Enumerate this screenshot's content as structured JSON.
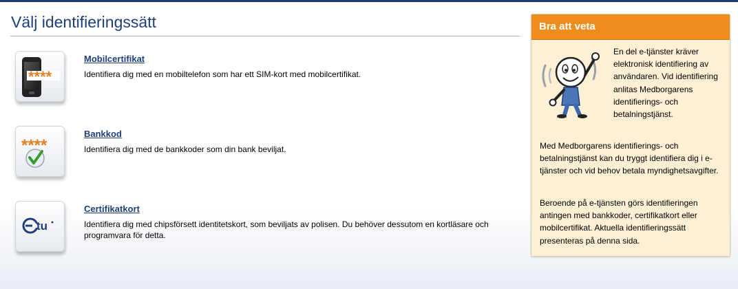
{
  "page": {
    "title": "Välj identifieringssätt"
  },
  "methods": [
    {
      "icon": "mobile-phone-icon",
      "icon_text": "****",
      "label": "Mobilcertifikat",
      "description": "Identifiera dig med en mobiltelefon som har ett SIM-kort med mobilcertifikat."
    },
    {
      "icon": "bank-code-checkmark-icon",
      "icon_text": "****",
      "label": "Bankkod",
      "description": "Identifiera dig med de bankkoder som din bank beviljat."
    },
    {
      "icon": "etu-card-icon",
      "icon_text": "tu",
      "label": "Certifikatkort",
      "description": "Identifiera dig med chipsförsett identitetskort, som beviljats av polisen. Du behöver dessutom en kortläsare och programvara för detta."
    }
  ],
  "info": {
    "title": "Bra att veta",
    "figure_icon": "waving-figure-icon",
    "paragraph1": "En del e-tjänster kräver elektronisk identifiering av användaren. Vid identifiering anlitas Medborgarens identifierings- och betalningstjänst.",
    "paragraph2": "Med Medborgarens identifierings- och betalningstjänst kan du tryggt identifiera dig i e-tjänster och vid behov betala myndighetsavgifter.",
    "paragraph3": "Beroende på e-tjänsten görs identifieringen antingen med bankkoder, certifikatkort eller mobilcertifikat. Aktuella identifieringssätt presenteras på denna sida."
  },
  "colors": {
    "brand_blue": "#1d3f7a",
    "accent_orange": "#ee8d1d",
    "info_background": "#fdf0d5"
  }
}
